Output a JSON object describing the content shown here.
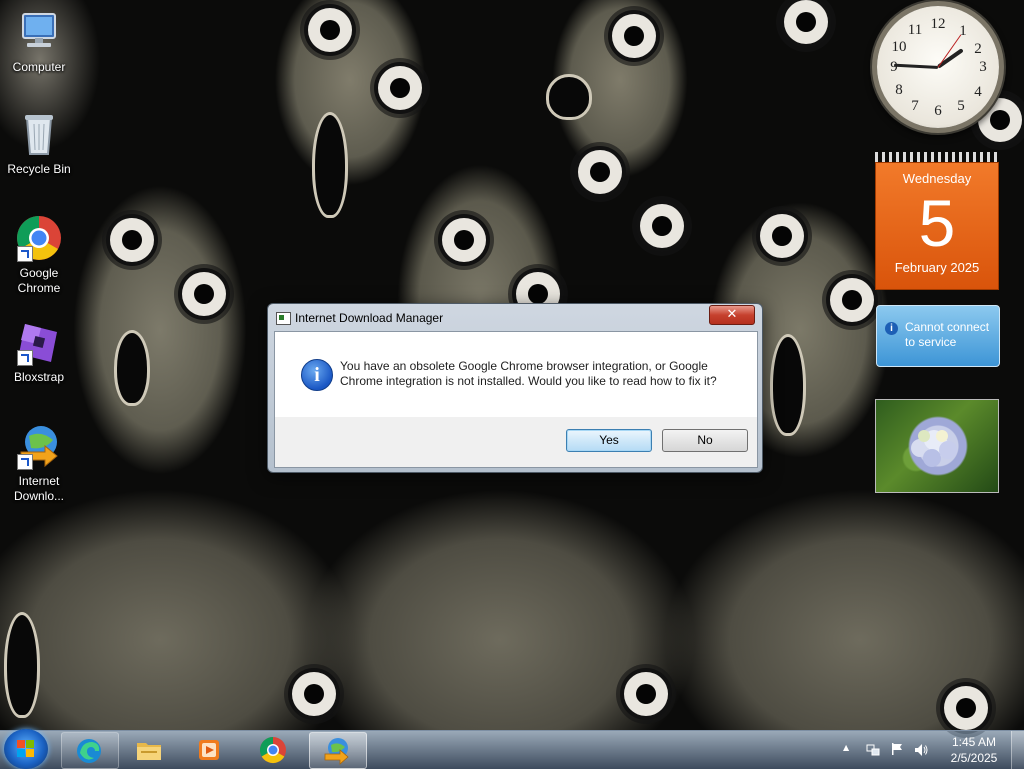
{
  "desktop": {
    "icons": [
      {
        "label": "Computer"
      },
      {
        "label": "Recycle Bin"
      },
      {
        "label": "Google Chrome"
      },
      {
        "label": "Bloxstrap"
      },
      {
        "label": "Internet Downlo..."
      }
    ]
  },
  "gadgets": {
    "clock": {
      "numbers": [
        "12",
        "1",
        "2",
        "3",
        "4",
        "5",
        "6",
        "7",
        "8",
        "9",
        "10",
        "11"
      ]
    },
    "calendar": {
      "weekday": "Wednesday",
      "day": "5",
      "month_year": "February 2025"
    },
    "weather": {
      "message": "Cannot connect to service",
      "info_icon": "i"
    }
  },
  "dialog": {
    "title": "Internet Download Manager",
    "close_glyph": "✕",
    "info_glyph": "i",
    "message": "You have an obsolete Google Chrome browser integration, or Google Chrome integration is not installed. Would you like to read how to fix it?",
    "yes_label": "Yes",
    "no_label": "No"
  },
  "taskbar": {
    "pinned": [
      {
        "name": "Microsoft Edge",
        "icon": "edge-icon"
      },
      {
        "name": "Windows Explorer",
        "icon": "folder-icon"
      },
      {
        "name": "Media Player",
        "icon": "media-player-icon"
      },
      {
        "name": "Google Chrome",
        "icon": "chrome-icon"
      },
      {
        "name": "Internet Download Manager",
        "icon": "idm-icon"
      }
    ],
    "tray": {
      "expand_glyph": "▲"
    },
    "time": "1:45 AM",
    "date": "2/5/2025"
  },
  "colors": {
    "calendar_orange": "#e8651a",
    "dialog_close_red": "#c6412e",
    "info_blue": "#1a57c4",
    "taskbar": "#2e4157"
  }
}
